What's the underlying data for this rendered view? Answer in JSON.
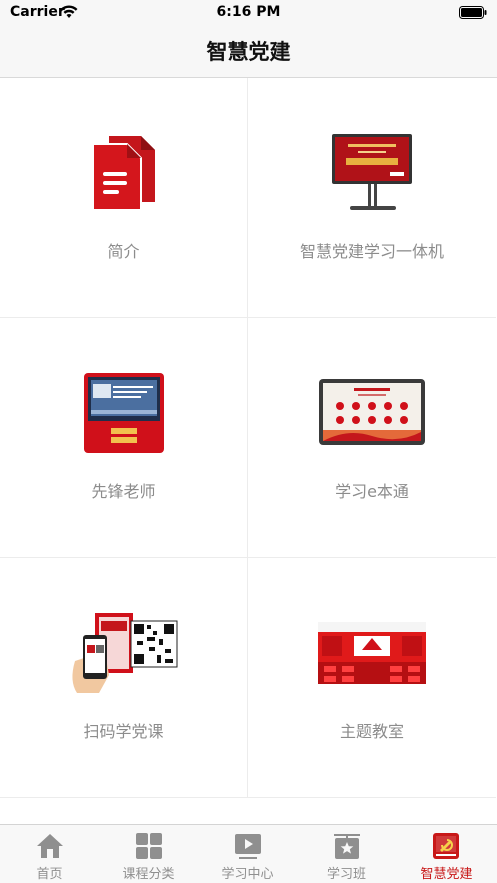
{
  "status_bar": {
    "carrier": "Carrier",
    "time": "6:16 PM"
  },
  "nav": {
    "title": "智慧党建"
  },
  "grid": {
    "items": [
      {
        "label": "简介",
        "icon": "document-icon"
      },
      {
        "label": "智慧党建学习一体机",
        "icon": "learning-kiosk-icon"
      },
      {
        "label": "先锋老师",
        "icon": "vanguard-teacher-terminal-icon"
      },
      {
        "label": "学习e本通",
        "icon": "e-study-tablet-icon"
      },
      {
        "label": "扫码学党课",
        "icon": "qr-scan-phone-icon"
      },
      {
        "label": "主题教室",
        "icon": "themed-classroom-icon"
      }
    ]
  },
  "tabs": [
    {
      "label": "首页",
      "icon": "home-icon",
      "active": false
    },
    {
      "label": "课程分类",
      "icon": "category-grid-icon",
      "active": false
    },
    {
      "label": "学习中心",
      "icon": "video-play-icon",
      "active": false
    },
    {
      "label": "学习班",
      "icon": "class-star-icon",
      "active": false
    },
    {
      "label": "智慧党建",
      "icon": "party-emblem-icon",
      "active": true
    }
  ],
  "colors": {
    "accent": "#c81818",
    "inactive": "#8f8f8f",
    "brand_red": "#c4161c"
  }
}
